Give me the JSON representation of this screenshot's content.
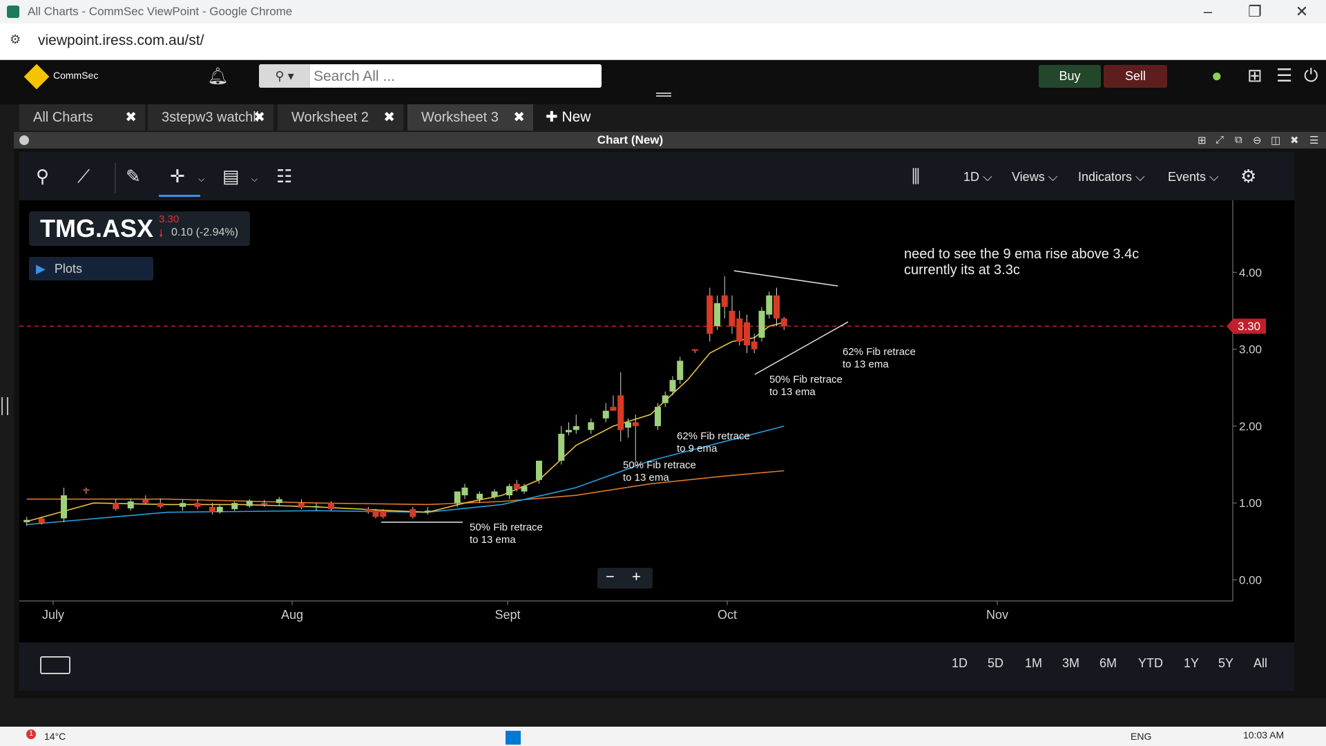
{
  "window": {
    "title": "All Charts - CommSec ViewPoint - Google Chrome"
  },
  "browser": {
    "url": "viewpoint.iress.com.au/st/"
  },
  "app": {
    "logo": "CommSec",
    "search_placeholder": "Search All ...",
    "buy_label": "Buy",
    "sell_label": "Sell"
  },
  "tabs": [
    {
      "label": "All Charts"
    },
    {
      "label": "3stepw3 watchli"
    },
    {
      "label": "Worksheet 2"
    },
    {
      "label": "Worksheet 3"
    }
  ],
  "new_tab_label": "New",
  "chart_window": {
    "title": "Chart (New)"
  },
  "toolbar": {
    "interval": "1D",
    "views": "Views",
    "indicators": "Indicators",
    "events": "Events"
  },
  "symbol": {
    "ticker": "TMG.ASX",
    "price": "3.30",
    "change": "0.10 (-2.94%)",
    "change_color": "#e0303a"
  },
  "plots_label": "Plots",
  "range_buttons": [
    "1D",
    "5D",
    "1M",
    "3M",
    "6M",
    "YTD",
    "1Y",
    "5Y",
    "All"
  ],
  "chart_data": {
    "type": "candlestick",
    "x_labels": [
      "July",
      "Aug",
      "Sept",
      "Oct",
      "Nov"
    ],
    "y_ticks": [
      "4.00",
      "3.00",
      "2.00",
      "1.00",
      "0.00"
    ],
    "ylim": [
      0,
      4.6
    ],
    "last_price": "3.30",
    "colors": {
      "up": "#9fd07c",
      "down": "#d83a26",
      "ema9": "#e8c547",
      "ema13": "#2aa0dc",
      "ema_slow": "#e07a2a",
      "price_line": "#c0202a"
    },
    "candles": [
      {
        "d": 1,
        "o": 0.75,
        "h": 0.82,
        "l": 0.7,
        "c": 0.78
      },
      {
        "d": 3,
        "o": 0.8,
        "h": 0.82,
        "l": 0.72,
        "c": 0.74
      },
      {
        "d": 6,
        "o": 0.8,
        "h": 1.2,
        "l": 0.75,
        "c": 1.1
      },
      {
        "d": 9,
        "o": 1.18,
        "h": 1.2,
        "l": 1.12,
        "c": 1.16
      },
      {
        "d": 13,
        "o": 1.0,
        "h": 1.05,
        "l": 0.9,
        "c": 0.92
      },
      {
        "d": 15,
        "o": 0.93,
        "h": 1.05,
        "l": 0.9,
        "c": 1.02
      },
      {
        "d": 17,
        "o": 1.05,
        "h": 1.1,
        "l": 0.98,
        "c": 1.0
      },
      {
        "d": 19,
        "o": 1.0,
        "h": 1.06,
        "l": 0.93,
        "c": 0.95
      },
      {
        "d": 22,
        "o": 0.95,
        "h": 1.05,
        "l": 0.9,
        "c": 1.0
      },
      {
        "d": 24,
        "o": 1.0,
        "h": 1.05,
        "l": 0.92,
        "c": 0.95
      },
      {
        "d": 26,
        "o": 0.95,
        "h": 1.0,
        "l": 0.85,
        "c": 0.88
      },
      {
        "d": 27,
        "o": 0.88,
        "h": 0.98,
        "l": 0.86,
        "c": 0.95
      },
      {
        "d": 29,
        "o": 0.92,
        "h": 1.02,
        "l": 0.9,
        "c": 1.0
      },
      {
        "d": 31,
        "o": 0.96,
        "h": 1.05,
        "l": 0.94,
        "c": 1.03
      },
      {
        "d": 33,
        "o": 1.0,
        "h": 1.04,
        "l": 0.95,
        "c": 0.98
      },
      {
        "d": 35,
        "o": 1.0,
        "h": 1.08,
        "l": 0.96,
        "c": 1.05
      },
      {
        "d": 38,
        "o": 1.0,
        "h": 1.05,
        "l": 0.92,
        "c": 0.94
      },
      {
        "d": 40,
        "o": 0.95,
        "h": 1.0,
        "l": 0.9,
        "c": 0.96
      },
      {
        "d": 42,
        "o": 1.0,
        "h": 1.02,
        "l": 0.9,
        "c": 0.92
      },
      {
        "d": 47,
        "o": 0.92,
        "h": 0.95,
        "l": 0.86,
        "c": 0.88
      },
      {
        "d": 48,
        "o": 0.9,
        "h": 0.92,
        "l": 0.8,
        "c": 0.82
      },
      {
        "d": 49,
        "o": 0.9,
        "h": 0.92,
        "l": 0.8,
        "c": 0.82
      },
      {
        "d": 53,
        "o": 0.92,
        "h": 0.95,
        "l": 0.8,
        "c": 0.82
      },
      {
        "d": 55,
        "o": 0.88,
        "h": 0.95,
        "l": 0.85,
        "c": 0.9
      },
      {
        "d": 59,
        "o": 1.0,
        "h": 1.15,
        "l": 0.95,
        "c": 1.15
      },
      {
        "d": 60,
        "o": 1.1,
        "h": 1.25,
        "l": 1.05,
        "c": 1.2
      },
      {
        "d": 62,
        "o": 1.05,
        "h": 1.15,
        "l": 1.0,
        "c": 1.12
      },
      {
        "d": 64,
        "o": 1.08,
        "h": 1.18,
        "l": 1.05,
        "c": 1.15
      },
      {
        "d": 66,
        "o": 1.1,
        "h": 1.25,
        "l": 1.05,
        "c": 1.22
      },
      {
        "d": 67,
        "o": 1.25,
        "h": 1.3,
        "l": 1.15,
        "c": 1.18
      },
      {
        "d": 68,
        "o": 1.15,
        "h": 1.25,
        "l": 1.12,
        "c": 1.22
      },
      {
        "d": 70,
        "o": 1.3,
        "h": 1.55,
        "l": 1.25,
        "c": 1.55
      },
      {
        "d": 73,
        "o": 1.55,
        "h": 2.0,
        "l": 1.5,
        "c": 1.9
      },
      {
        "d": 74,
        "o": 1.92,
        "h": 2.05,
        "l": 1.88,
        "c": 1.95
      },
      {
        "d": 75,
        "o": 1.95,
        "h": 2.15,
        "l": 1.9,
        "c": 2.0
      },
      {
        "d": 77,
        "o": 1.95,
        "h": 2.1,
        "l": 1.9,
        "c": 2.05
      },
      {
        "d": 79,
        "o": 2.1,
        "h": 2.3,
        "l": 2.05,
        "c": 2.2
      },
      {
        "d": 80,
        "o": 2.25,
        "h": 2.4,
        "l": 2.2,
        "c": 2.2
      },
      {
        "d": 81,
        "o": 2.4,
        "h": 2.7,
        "l": 1.8,
        "c": 1.95
      },
      {
        "d": 82,
        "o": 1.98,
        "h": 2.1,
        "l": 1.85,
        "c": 2.05
      },
      {
        "d": 83,
        "o": 2.05,
        "h": 2.15,
        "l": 1.55,
        "c": 2.0
      },
      {
        "d": 86,
        "o": 2.0,
        "h": 2.3,
        "l": 1.95,
        "c": 2.25
      },
      {
        "d": 87,
        "o": 2.3,
        "h": 2.45,
        "l": 2.25,
        "c": 2.4
      },
      {
        "d": 88,
        "o": 2.45,
        "h": 2.65,
        "l": 2.4,
        "c": 2.6
      },
      {
        "d": 89,
        "o": 2.6,
        "h": 2.9,
        "l": 2.55,
        "c": 2.85
      },
      {
        "d": 91,
        "o": 3.0,
        "h": 3.0,
        "l": 2.95,
        "c": 2.98
      },
      {
        "d": 93,
        "o": 3.7,
        "h": 3.8,
        "l": 3.1,
        "c": 3.2
      },
      {
        "d": 94,
        "o": 3.3,
        "h": 3.7,
        "l": 3.25,
        "c": 3.6
      },
      {
        "d": 95,
        "o": 3.7,
        "h": 3.95,
        "l": 3.4,
        "c": 3.55
      },
      {
        "d": 96,
        "o": 3.5,
        "h": 3.7,
        "l": 3.2,
        "c": 3.3
      },
      {
        "d": 97,
        "o": 3.4,
        "h": 3.5,
        "l": 3.05,
        "c": 3.1
      },
      {
        "d": 98,
        "o": 3.35,
        "h": 3.45,
        "l": 2.95,
        "c": 3.05
      },
      {
        "d": 99,
        "o": 3.1,
        "h": 3.2,
        "l": 2.95,
        "c": 3.0
      },
      {
        "d": 100,
        "o": 3.15,
        "h": 3.55,
        "l": 3.1,
        "c": 3.5
      },
      {
        "d": 101,
        "o": 3.45,
        "h": 3.75,
        "l": 3.4,
        "c": 3.7
      },
      {
        "d": 102,
        "o": 3.7,
        "h": 3.8,
        "l": 3.3,
        "c": 3.4
      },
      {
        "d": 103,
        "o": 3.4,
        "h": 3.42,
        "l": 3.25,
        "c": 3.3
      }
    ],
    "ema9": [
      [
        1,
        0.76
      ],
      [
        10,
        1.0
      ],
      [
        20,
        0.98
      ],
      [
        30,
        0.98
      ],
      [
        40,
        0.95
      ],
      [
        50,
        0.9
      ],
      [
        55,
        0.88
      ],
      [
        60,
        1.0
      ],
      [
        65,
        1.1
      ],
      [
        70,
        1.3
      ],
      [
        75,
        1.75
      ],
      [
        80,
        2.0
      ],
      [
        85,
        2.15
      ],
      [
        90,
        2.6
      ],
      [
        93,
        2.95
      ],
      [
        96,
        3.1
      ],
      [
        99,
        3.15
      ],
      [
        101,
        3.3
      ],
      [
        103,
        3.35
      ]
    ],
    "ema13": [
      [
        1,
        0.72
      ],
      [
        20,
        0.88
      ],
      [
        40,
        0.9
      ],
      [
        55,
        0.88
      ],
      [
        65,
        0.98
      ],
      [
        75,
        1.2
      ],
      [
        85,
        1.55
      ],
      [
        95,
        1.8
      ],
      [
        103,
        2.0
      ]
    ],
    "ema_slow": [
      [
        1,
        1.05
      ],
      [
        20,
        1.05
      ],
      [
        40,
        1.0
      ],
      [
        55,
        0.98
      ],
      [
        65,
        1.02
      ],
      [
        75,
        1.1
      ],
      [
        85,
        1.25
      ],
      [
        95,
        1.35
      ],
      [
        103,
        1.42
      ]
    ],
    "annotations": [
      {
        "lines": [
          "need to see the 9 ema rise above 3.4c",
          "currently its at 3.3c"
        ]
      },
      {
        "lines": [
          "62% Fib retrace",
          "to 13 ema"
        ]
      },
      {
        "lines": [
          "50% Fib retrace",
          "to 13 ema"
        ]
      },
      {
        "lines": [
          "62% Fib retrace",
          "to 9 ema"
        ]
      },
      {
        "lines": [
          "50% Fib retrace",
          "to 13 ema"
        ]
      },
      {
        "lines": [
          "50% Fib retrace",
          "to 13 ema"
        ]
      }
    ]
  },
  "status": {
    "temp": "14°C",
    "lang": "ENG",
    "time": "10:03 AM"
  }
}
